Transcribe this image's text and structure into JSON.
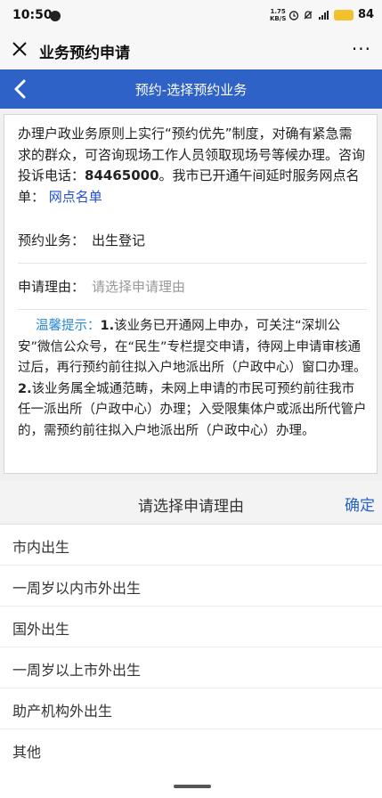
{
  "status": {
    "time": "10:50",
    "speed": "1.75\nKB/S",
    "battery": "84"
  },
  "wechat": {
    "title": "业务预约申请",
    "more": "···"
  },
  "header": {
    "title": "预约-选择预约业务"
  },
  "notice": {
    "text1": "办理户政业务原则上实行“预约优先”制度，对确有紧急需求的群众，可咨询现场工作人员领取现场号等候办理。咨询投诉电话：",
    "phone": "84465000",
    "text2": "。我市已开通午间延时服务网点名单：",
    "link": "网点名单"
  },
  "business": {
    "label": "预约业务：",
    "value": "出生登记"
  },
  "reason": {
    "label": "申请理由：",
    "placeholder": "请选择申请理由"
  },
  "tip": {
    "label": "温馨提示：",
    "n1": "1.",
    "t1": "该业务已开通网上申办，可关注“深圳公安”微信公众号，在“民生”专栏提交申请，待网上申请审核通过后，再行预约前往拟入户地派出所（户政中心）窗口办理。",
    "n2": "2.",
    "t2": "该业务属全城通范畴，未网上申请的市民可预约前往我市任一派出所（户政中心）办理；入受限集体户或派出所代管户的，需预约前往拟入户地派出所（户政中心）办理。"
  },
  "picker": {
    "title": "请选择申请理由",
    "confirm": "确定",
    "options": [
      "市内出生",
      "一周岁以内市外出生",
      "国外出生",
      "一周岁以上市外出生",
      "助产机构外出生",
      "其他"
    ]
  }
}
